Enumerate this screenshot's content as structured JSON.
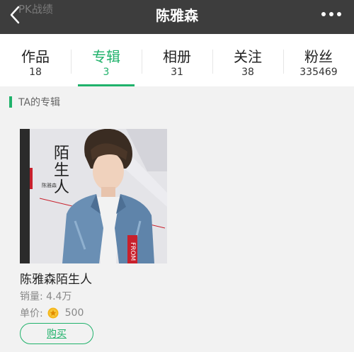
{
  "header": {
    "ghost_text": "PK战绩",
    "title": "陈雅森",
    "back_icon": "back-arrow-icon",
    "more_icon": "more-dots-icon"
  },
  "tabs": [
    {
      "label": "作品",
      "count": "18",
      "active": false
    },
    {
      "label": "专辑",
      "count": "3",
      "active": true
    },
    {
      "label": "相册",
      "count": "31",
      "active": false
    },
    {
      "label": "关注",
      "count": "38",
      "active": false
    },
    {
      "label": "粉丝",
      "count": "335469",
      "active": false
    }
  ],
  "section": {
    "title": "TA的专辑"
  },
  "album": {
    "cover_title": "陌生人",
    "cover_artist": "陈雅森",
    "cover_side_text": "FROM",
    "name": "陈雅森陌生人",
    "sales": "销量: 4.4万",
    "price_label": "单价:",
    "price_icon": "coin-icon",
    "price_value": "500",
    "buy_label": "购买"
  },
  "colors": {
    "accent": "#20b26b",
    "header_bg": "#3d3d3d",
    "section_bg": "#f2f2f2"
  }
}
